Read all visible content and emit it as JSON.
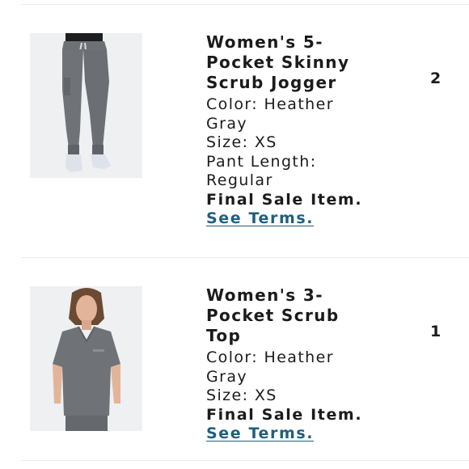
{
  "cart": {
    "items": [
      {
        "name": "Women's 5-Pocket Skinny Scrub Jogger",
        "color": "Color: Heather Gray",
        "size": "Size: XS",
        "pant_length": "Pant Length: Regular",
        "final_sale": "Final Sale Item.",
        "terms_link": "See Terms.",
        "quantity": "2",
        "image_icon": "product-photo-jogger"
      },
      {
        "name": "Women's 3-Pocket Scrub Top",
        "color": "Color: Heather Gray",
        "size": "Size: XS",
        "final_sale": "Final Sale Item.",
        "terms_link": "See Terms.",
        "quantity": "1",
        "image_icon": "product-photo-top"
      }
    ]
  },
  "colors": {
    "link": "#1f5f7d",
    "fabric": "#6f7378",
    "background": "#ffffff"
  }
}
